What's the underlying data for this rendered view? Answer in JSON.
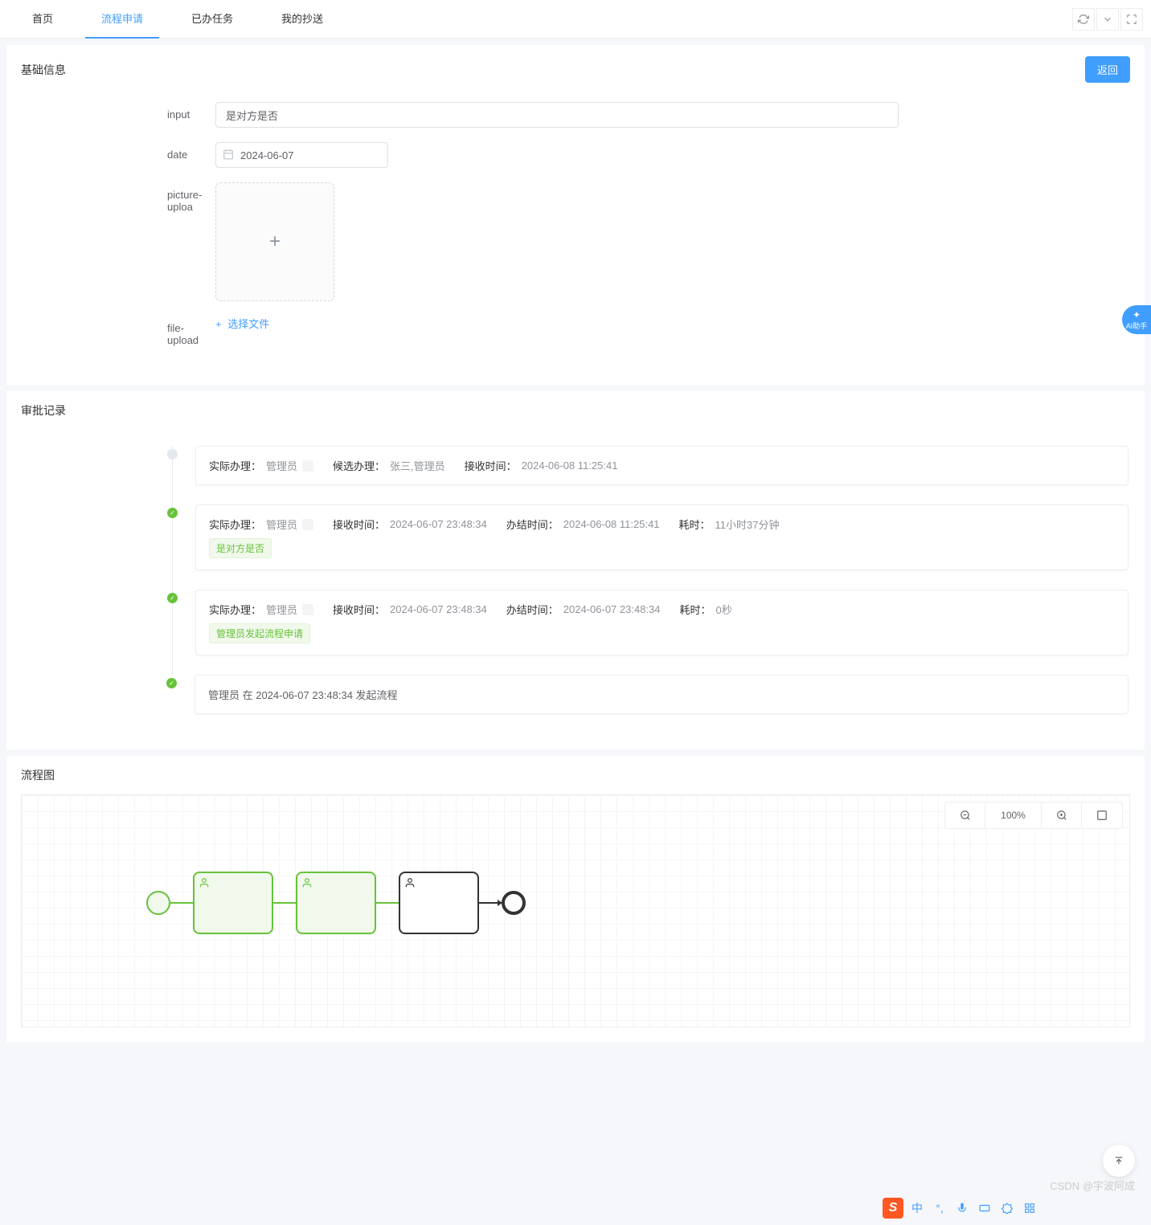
{
  "tabs": {
    "home": "首页",
    "apply": "流程申请",
    "done": "已办任务",
    "cc": "我的抄送"
  },
  "panels": {
    "basic_info": "基础信息",
    "approval_records": "审批记录",
    "flow_chart": "流程图"
  },
  "buttons": {
    "back": "返回"
  },
  "form": {
    "input_label": "input",
    "input_value": "是对方是否",
    "date_label": "date",
    "date_value": "2024-06-07",
    "picture_label": "picture-uploa",
    "file_label": "file-upload",
    "file_select": "选择文件"
  },
  "records": {
    "labels": {
      "actual_handler": "实际办理：",
      "candidate_handler": "候选办理：",
      "receive_time": "接收时间：",
      "finish_time": "办结时间：",
      "duration": "耗时："
    },
    "item1": {
      "actual_handler": "管理员",
      "candidate_handler": "张三,管理员",
      "receive_time": "2024-06-08 11:25:41"
    },
    "item2": {
      "actual_handler": "管理员",
      "receive_time": "2024-06-07 23:48:34",
      "finish_time": "2024-06-08 11:25:41",
      "duration": "11小时37分钟",
      "comment": "是对方是否"
    },
    "item3": {
      "actual_handler": "管理员",
      "receive_time": "2024-06-07 23:48:34",
      "finish_time": "2024-06-07 23:48:34",
      "duration": "0秒",
      "comment": "管理员发起流程申请"
    },
    "item4": {
      "text": "管理员 在 2024-06-07 23:48:34 发起流程"
    }
  },
  "flow": {
    "zoom": "100%"
  },
  "ai_helper": "AI助手",
  "ime": {
    "zhong": "中"
  },
  "watermark": "CSDN @宇波阿成"
}
